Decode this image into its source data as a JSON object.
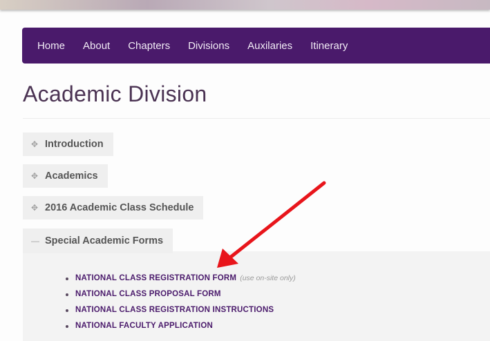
{
  "nav": {
    "items": [
      {
        "label": "Home"
      },
      {
        "label": "About"
      },
      {
        "label": "Chapters"
      },
      {
        "label": "Divisions"
      },
      {
        "label": "Auxilaries"
      },
      {
        "label": "Itinerary"
      }
    ]
  },
  "page": {
    "title": "Academic Division"
  },
  "accordion": {
    "sections": [
      {
        "label": "Introduction",
        "icon": "plus-icon",
        "expanded": false
      },
      {
        "label": "Academics",
        "icon": "plus-icon",
        "expanded": false
      },
      {
        "label": "2016 Academic Class Schedule",
        "icon": "plus-icon",
        "expanded": false
      },
      {
        "label": "Special Academic Forms",
        "icon": "minus-icon",
        "expanded": true
      }
    ]
  },
  "forms": {
    "links": [
      {
        "label": "NATIONAL CLASS REGISTRATION FORM",
        "note": "(use on-site only)"
      },
      {
        "label": "NATIONAL CLASS PROPOSAL FORM"
      },
      {
        "label": "NATIONAL CLASS REGISTRATION INSTRUCTIONS"
      },
      {
        "label": "NATIONAL FACULTY APPLICATION"
      }
    ]
  },
  "colors": {
    "nav_background": "#4a1a6b",
    "link": "#4a1a6b",
    "annotation_arrow": "#e8151b"
  }
}
